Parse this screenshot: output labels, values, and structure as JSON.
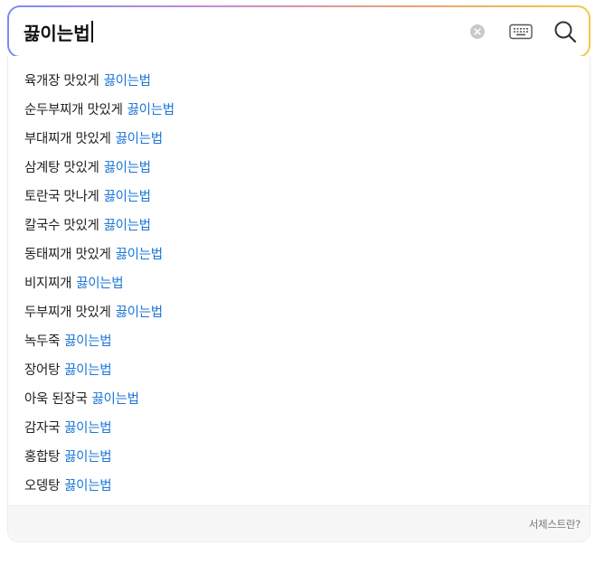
{
  "search": {
    "query": "끓이는법",
    "clear_icon": "clear-circle-icon",
    "keyboard_icon": "keyboard-icon",
    "search_icon": "magnifier-icon"
  },
  "suggestions": [
    {
      "prefix": "육개장 맛있게",
      "match": "끓이는법"
    },
    {
      "prefix": "순두부찌개 맛있게",
      "match": "끓이는법"
    },
    {
      "prefix": "부대찌개 맛있게",
      "match": "끓이는법"
    },
    {
      "prefix": "삼계탕 맛있게",
      "match": "끓이는법"
    },
    {
      "prefix": "토란국 맛나게",
      "match": "끓이는법"
    },
    {
      "prefix": "칼국수 맛있게",
      "match": "끓이는법"
    },
    {
      "prefix": "동태찌개 맛있게",
      "match": "끓이는법"
    },
    {
      "prefix": "비지찌개",
      "match": "끓이는법"
    },
    {
      "prefix": "두부찌개 맛있게",
      "match": "끓이는법"
    },
    {
      "prefix": "녹두죽",
      "match": "끓이는법"
    },
    {
      "prefix": "장어탕",
      "match": "끓이는법"
    },
    {
      "prefix": "아욱 된장국",
      "match": "끓이는법"
    },
    {
      "prefix": "감자국",
      "match": "끓이는법"
    },
    {
      "prefix": "홍합탕",
      "match": "끓이는법"
    },
    {
      "prefix": "오뎅탕",
      "match": "끓이는법"
    }
  ],
  "footer": {
    "link_label": "서제스트란?"
  },
  "colors": {
    "highlight": "#1b77d8",
    "gradient": [
      "#7a8cf0",
      "#c58ad8",
      "#f0a070",
      "#f5c64a"
    ]
  }
}
